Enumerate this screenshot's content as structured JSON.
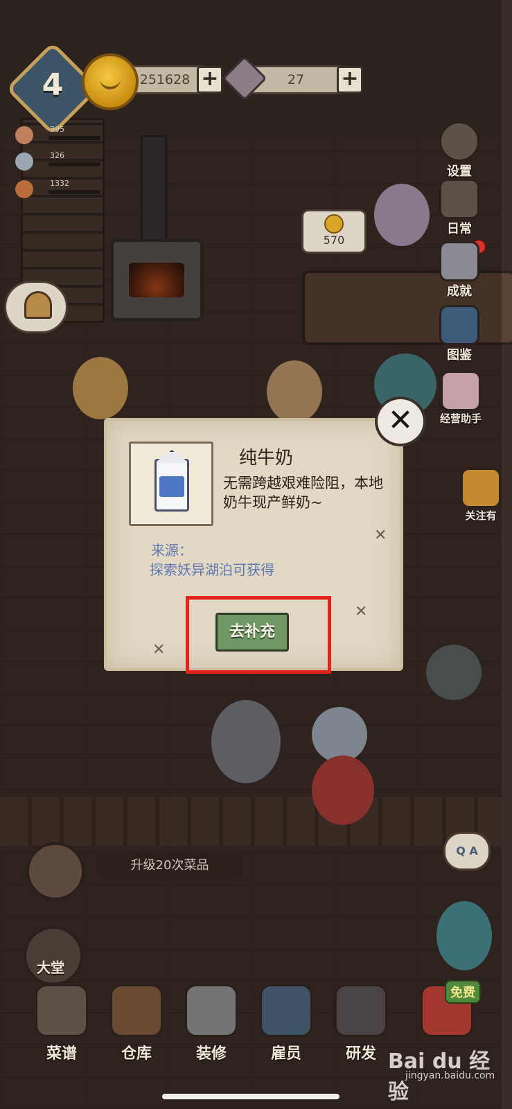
{
  "hud": {
    "level": "4",
    "coins": "251628",
    "gems": "27",
    "plus_symbol": "+"
  },
  "stats": [
    {
      "value": "395",
      "icon": "food-icon"
    },
    {
      "value": "326",
      "icon": "footprint-icon"
    },
    {
      "value": "1332",
      "icon": "mushroom-icon"
    }
  ],
  "side_menu": {
    "settings": "设置",
    "daily": "日常",
    "achievements": "成就",
    "collection": "图鉴",
    "assistant": "经营助手",
    "follow": "关注有"
  },
  "counter_price": "570",
  "dialog": {
    "title": "纯牛奶",
    "description": "无需跨越艰难险阻，本地奶牛现产鲜奶~",
    "source_label": "来源：",
    "source_text": "探索妖异湖泊可获得",
    "button_label": "去补充",
    "close_symbol": "✕"
  },
  "upgrade_banner": "升级20次菜品",
  "lobby": "大堂",
  "qa": "Q A",
  "bottom_nav": [
    {
      "label": "菜谱"
    },
    {
      "label": "仓库"
    },
    {
      "label": "装修"
    },
    {
      "label": "雇员"
    },
    {
      "label": "研发"
    },
    {
      "label": "免费"
    }
  ],
  "watermark": {
    "brand": "Bai du 经验",
    "url": "jingyan.baidu.com"
  },
  "colors": {
    "highlight": "#e3231a",
    "button": "#6f9864",
    "source_text": "#5f78b4"
  }
}
